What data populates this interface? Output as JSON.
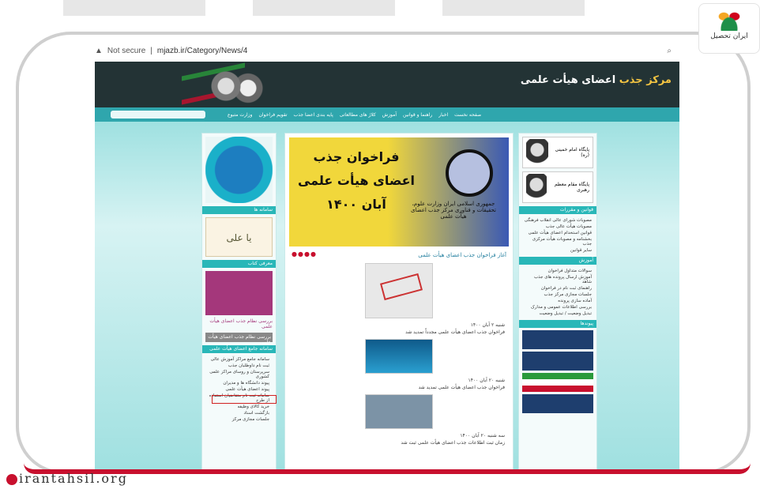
{
  "browser": {
    "security_label": "Not secure",
    "url": "mjazb.ir/Category/News/4"
  },
  "site": {
    "title_part1": "مرکز جذب",
    "title_part2": "اعضای هیأت علمی",
    "nav": [
      "صفحه نخست",
      "اخبار",
      "راهنما و قوانین",
      "آموزش",
      "کلاژ های مطالعاتی",
      "پایه بندی اعضا جذب",
      "تقویم فراخوان",
      "وزارت متبوع"
    ]
  },
  "banner": {
    "headline": "فراخوان جذب اعضای هیأت علمی آبان ۱۴۰۰",
    "sub": "جمهوری اسلامی ایران وزارت علوم، تحقیقات و فناوری مرکز جذب اعضای هیأت علمی",
    "caption": "آغاز فراخوان جذب اعضای هیأت علمی"
  },
  "left": {
    "box1": "سامانه ها",
    "calligraphy": "یا علی",
    "box2": "معرفی کتاب",
    "purple_text": "بررسی نظام جذب اعضای هیأت علمی",
    "gray_btn": "بررسی نظام جذب اعضای هیأت علمی",
    "list_title": "سامانه جامع اعضای هیأت علمی",
    "items": [
      "سامانه جامع مراکز آموزش عالی",
      "ثبت نام داوطلبان جذب",
      "سرپرستان و روسای مراکز علمی کشوری",
      "پیوند دانشگاه ها و مدیران",
      "پیوند اعضای هیأت علمی",
      "سامانه ثبت نام متقاضیان استفاده از طرح",
      "خرید کالای وظیفه",
      "بازگشت اسناد",
      "جلسات مجازی مرکز"
    ]
  },
  "news": [
    {
      "date": "شنبه ۲ آبان ۱۴۰۰",
      "title": "فراخوان جذب اعضای هیأت علمی مجدداً تمدید شد"
    },
    {
      "date": "شنبه ۲۰ آبان ۱۴۰۰",
      "title": "فراخوان جذب اعضای هیأت علمی تمدید شد"
    },
    {
      "date": "سه شنبه ۲۰ آبان ۱۴۰۰",
      "title": "زمان ثبت اطلاعات جذب اعضای هیأت علمی ثبت شد"
    }
  ],
  "right": {
    "card1": "پایگاه امام خمینی (ره)",
    "card2": "پایگاه مقام معظم رهبری",
    "laws_title": "قوانین و مقررات",
    "laws": [
      "مصوبات شورای عالی انقلاب فرهنگی",
      "مصوبات هیأت عالی جذب",
      "قوانین استخدام اعضای هیأت علمی",
      "بخشنامه و مصوبات هیأت مرکزی جذب",
      "سایر قوانین"
    ],
    "edu_title": "آموزش",
    "edu": [
      "سوالات متداول فراخوان",
      "آموزش ارسال پرونده های جذب شاهد",
      "راهنمای ثبت نام در فراخوان",
      "جلسات مجازی مرکز جذب",
      "آماده سازی پرونده",
      "بررسی اطلاعات عمومی و مدارک",
      "تبدیل وضعیت / تبدیل وضعیت"
    ],
    "links_title": "پیوندها"
  },
  "logo": {
    "name": "ایران تحصیل"
  },
  "watermark": "irantahsil.org"
}
